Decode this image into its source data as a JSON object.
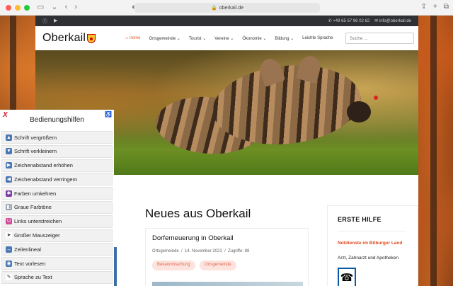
{
  "browser": {
    "url": "oberkail.de",
    "colors": {
      "close": "#ff5f57",
      "min": "#febc2e",
      "max": "#28c840"
    }
  },
  "topbar": {
    "phone": "+49 65 67 96 02 62",
    "email": "info@oberkail.de"
  },
  "header": {
    "logo": "Oberkail",
    "nav": [
      {
        "label": "Home",
        "active": true
      },
      {
        "label": "Ortsgemeinde"
      },
      {
        "label": "Tourist"
      },
      {
        "label": "Vereine"
      },
      {
        "label": "Ökonomie"
      },
      {
        "label": "Bildung"
      },
      {
        "label": "Leichte Sprache"
      }
    ],
    "search_placeholder": "Suche ..."
  },
  "main": {
    "heading": "Neues aus Oberkail",
    "post": {
      "title": "Dorferneuerung in Oberkail",
      "category": "Ortsgemeinde",
      "date": "14. November 2021",
      "hits": "Zugriffe: 88",
      "tags": [
        "Bekanntmachung",
        "Ortsgemeinde"
      ]
    }
  },
  "sidebar": {
    "title": "ERSTE HILFE",
    "highlight": "Notdienste im Bitburger Land",
    "text": "Arzt, Zahnarzt und Apotheken"
  },
  "a11y": {
    "close": "X",
    "title": "Bedienungshilfen",
    "items": [
      {
        "label": "Schrift vergrößern",
        "icon": "arrow-up-icon",
        "color": "#4a77b4"
      },
      {
        "label": "Schrift verkleinern",
        "icon": "arrow-down-icon",
        "color": "#4a77b4"
      },
      {
        "label": "Zeichenabstand erhöhen",
        "icon": "arrow-right-icon",
        "color": "#4a77b4"
      },
      {
        "label": "Zeichenabstand verringern",
        "icon": "arrow-left-icon",
        "color": "#4a77b4"
      },
      {
        "label": "Farben umkehren",
        "icon": "invert-icon",
        "color": "#7d3ca3"
      },
      {
        "label": "Graue Farbtöne",
        "icon": "grayscale-icon",
        "color": "#9aa3ad"
      },
      {
        "label": "Links unterstreichen",
        "icon": "underline-icon",
        "color": "#d04a9a"
      },
      {
        "label": "Großer Mauszeiger",
        "icon": "cursor-icon",
        "color": "#333333"
      },
      {
        "label": "Zeilenlineal",
        "icon": "ruler-icon",
        "color": "#4a77b4"
      },
      {
        "label": "Text vorlesen",
        "icon": "speaker-icon",
        "color": "#4a77b4"
      },
      {
        "label": "Sprache zu Text",
        "icon": "microphone-icon",
        "color": "#333333"
      }
    ]
  }
}
